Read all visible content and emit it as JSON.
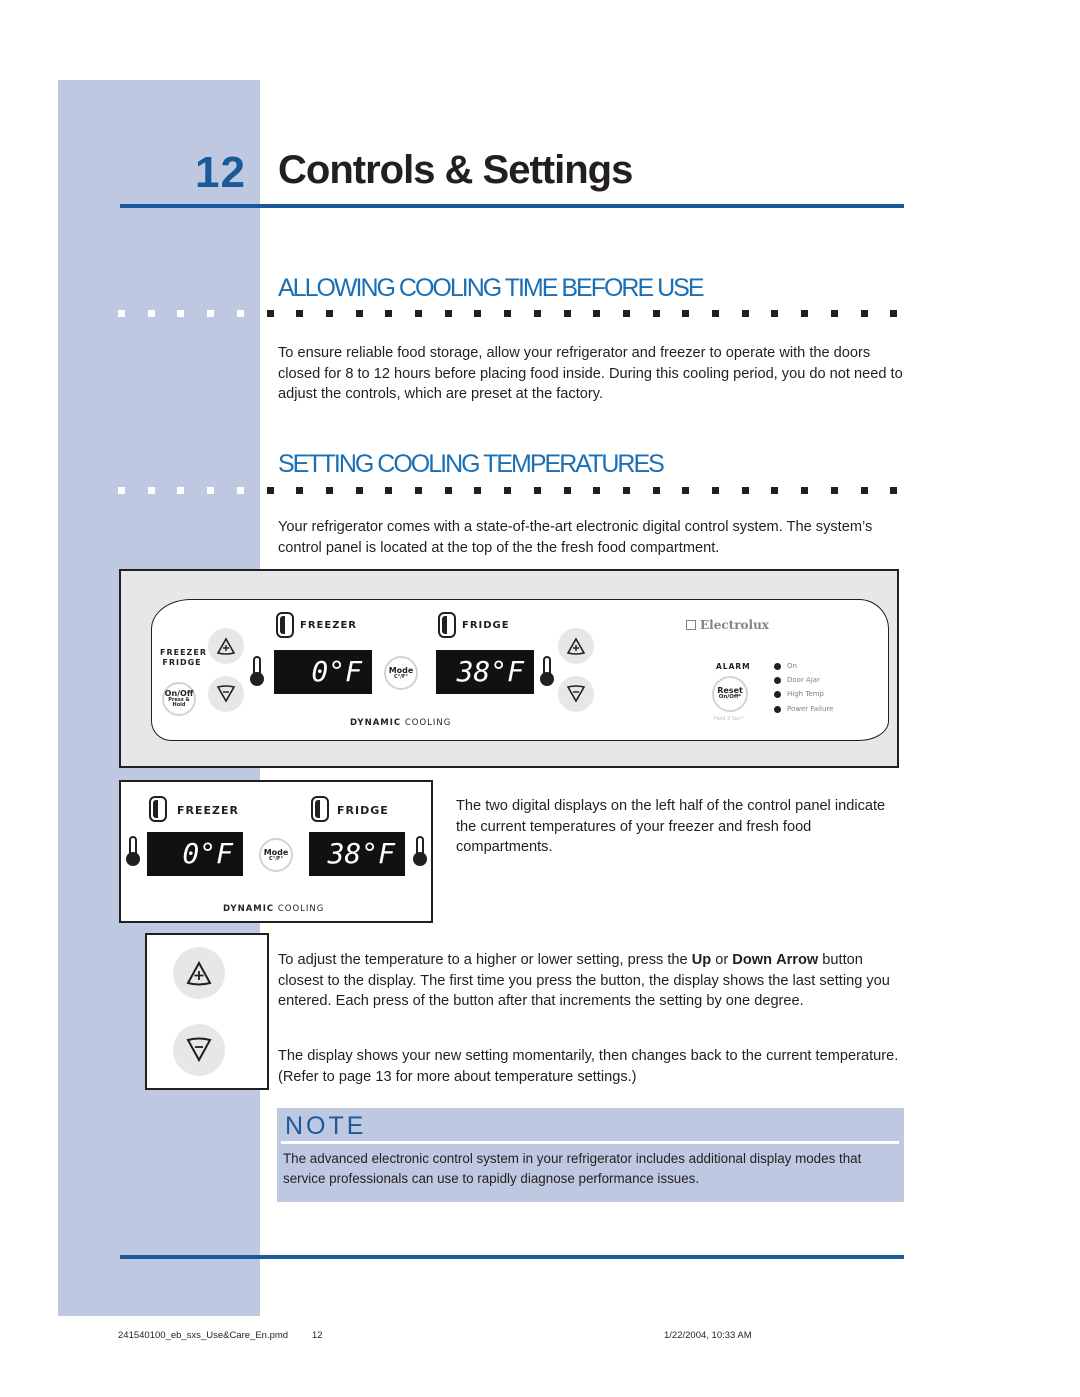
{
  "header": {
    "chapter_number": "12",
    "chapter_title": "Controls & Settings"
  },
  "sections": [
    {
      "title": "ALLOWING COOLING TIME BEFORE USE",
      "body": "To ensure reliable food storage, allow your refrigerator and freezer to operate with the doors closed for 8 to 12 hours before placing food inside. During this cooling period, you do not need to adjust the controls, which are preset at the factory."
    },
    {
      "title": "SETTING COOLING TEMPERATURES",
      "body": "Your refrigerator comes with a state-of-the-art electronic digital control system. The system’s control panel is located at the top of the the fresh food compartment."
    }
  ],
  "control_panel": {
    "left_label_line1": "FREEZER",
    "left_label_line2": "FRIDGE",
    "onoff_label": "On/Off",
    "onoff_sub1": "Press &",
    "onoff_sub2": "Hold",
    "freezer_label": "FREEZER",
    "fridge_label": "FRIDGE",
    "freezer_display": "0°F",
    "fridge_display": "38°F",
    "mode_label": "Mode",
    "mode_sub": "C°/F°",
    "dynamic_bold": "DYNAMIC",
    "dynamic_rest": " COOLING",
    "brand": "Electrolux",
    "alarm_label": "ALARM",
    "reset_label": "Reset",
    "reset_sub": "On/Off*",
    "hold_note": "Hold 3 Sec*",
    "indicators": [
      "On",
      "Door Ajar",
      "High Temp",
      "Power Failure"
    ],
    "plus_icon": "+",
    "minus_icon": "−"
  },
  "display_caption": "The two digital displays on the left half of the control panel indicate the current temperatures of your freezer and fresh food compartments.",
  "adjust_text": {
    "part1": "To adjust the temperature to a higher or lower setting, press the ",
    "up": "Up",
    "or": " or ",
    "down": "Down",
    "arrow": "Arrow",
    "part2": " button closest to the display. The first time you press the button, the display shows the last setting you entered. Each press of the button after that increments the setting by one degree."
  },
  "display_text": "The display shows your new setting momentarily, then changes back to the current temperature. (Refer to page 13 for more about temperature settings.)",
  "note": {
    "title": "NOTE",
    "body": "The advanced electronic control system in your refrigerator includes additional display modes that service professionals can use to rapidly diagnose performance issues."
  },
  "footer": {
    "filename": "241540100_eb_sxs_Use&Care_En.pmd",
    "page": "12",
    "timestamp": "1/22/2004, 10:33 AM"
  },
  "colors": {
    "sidebar": "#bfc8e1",
    "accent_blue": "#1a5a9a",
    "heading_blue": "#1a6fb5"
  }
}
